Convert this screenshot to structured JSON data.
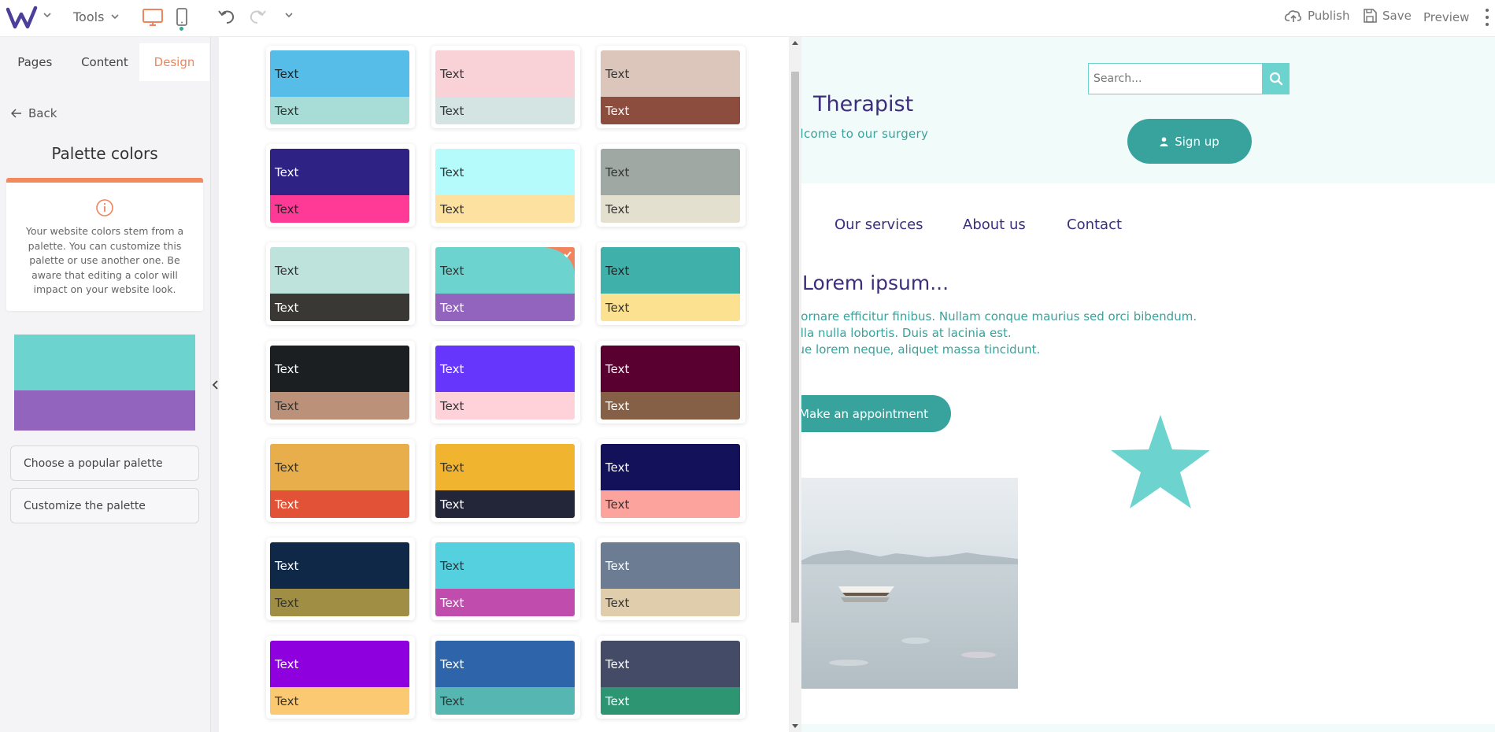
{
  "topbar": {
    "tools_label": "Tools",
    "publish_label": "Publish",
    "save_label": "Save",
    "preview_label": "Preview"
  },
  "colors": {
    "accent_orange": "#f0845e",
    "brand_purple": "#3d2e7c",
    "teal_primary": "#38a39d",
    "teal_light": "#6dd3cf"
  },
  "sidebar": {
    "tabs": [
      {
        "label": "Pages",
        "active": false
      },
      {
        "label": "Content",
        "active": false
      },
      {
        "label": "Design",
        "active": true
      }
    ],
    "back_label": "Back",
    "title": "Palette colors",
    "info_text": "Your website colors stem from a palette. You can customize this palette or use another one. Be aware that editing a color will impact on your website look.",
    "current_palette": {
      "primary": "#6dd3cf",
      "secondary": "#9264bd"
    },
    "choose_label": "Choose a popular palette",
    "customize_label": "Customize the palette"
  },
  "palettes": [
    {
      "top": "#56bde8",
      "top_text": "#222222",
      "bottom": "#a7ddd6",
      "bottom_text": "#333333",
      "label": "Text",
      "selected": false
    },
    {
      "top": "#f9d2d8",
      "top_text": "#333333",
      "bottom": "#d4e4e3",
      "bottom_text": "#333333",
      "label": "Text",
      "selected": false
    },
    {
      "top": "#dcc6bc",
      "top_text": "#333333",
      "bottom": "#8c4d3f",
      "bottom_text": "#ffffff",
      "label": "Text",
      "selected": false
    },
    {
      "top": "#2e2385",
      "top_text": "#ffffff",
      "bottom": "#ff3a96",
      "bottom_text": "#222222",
      "label": "Text",
      "selected": false
    },
    {
      "top": "#b5fbfc",
      "top_text": "#333333",
      "bottom": "#fde1a0",
      "bottom_text": "#333333",
      "label": "Text",
      "selected": false
    },
    {
      "top": "#9fa8a2",
      "top_text": "#333333",
      "bottom": "#e4e0d0",
      "bottom_text": "#333333",
      "label": "Text",
      "selected": false
    },
    {
      "top": "#bee3dc",
      "top_text": "#333333",
      "bottom": "#3a3834",
      "bottom_text": "#ffffff",
      "label": "Text",
      "selected": false
    },
    {
      "top": "#6dd3cf",
      "top_text": "#333333",
      "bottom": "#9264bd",
      "bottom_text": "#ffffff",
      "label": "Text",
      "selected": true
    },
    {
      "top": "#3fb0aa",
      "top_text": "#222222",
      "bottom": "#fbe190",
      "bottom_text": "#333333",
      "label": "Text",
      "selected": false
    },
    {
      "top": "#1c1f22",
      "top_text": "#ffffff",
      "bottom": "#bb9279",
      "bottom_text": "#333333",
      "label": "Text",
      "selected": false
    },
    {
      "top": "#6636fc",
      "top_text": "#ffffff",
      "bottom": "#ffd1d8",
      "bottom_text": "#333333",
      "label": "Text",
      "selected": false
    },
    {
      "top": "#5a0031",
      "top_text": "#ffffff",
      "bottom": "#866046",
      "bottom_text": "#ffffff",
      "label": "Text",
      "selected": false
    },
    {
      "top": "#e7ae4b",
      "top_text": "#333333",
      "bottom": "#e25237",
      "bottom_text": "#ffffff",
      "label": "Text",
      "selected": false
    },
    {
      "top": "#f0b42f",
      "top_text": "#333333",
      "bottom": "#232638",
      "bottom_text": "#ffffff",
      "label": "Text",
      "selected": false
    },
    {
      "top": "#13115a",
      "top_text": "#ffffff",
      "bottom": "#fca39e",
      "bottom_text": "#333333",
      "label": "Text",
      "selected": false
    },
    {
      "top": "#0f2848",
      "top_text": "#ffffff",
      "bottom": "#a08e44",
      "bottom_text": "#333333",
      "label": "Text",
      "selected": false
    },
    {
      "top": "#54d0de",
      "top_text": "#333333",
      "bottom": "#c04dad",
      "bottom_text": "#ffffff",
      "label": "Text",
      "selected": false
    },
    {
      "top": "#6c7d93",
      "top_text": "#ffffff",
      "bottom": "#dfcdab",
      "bottom_text": "#333333",
      "label": "Text",
      "selected": false
    },
    {
      "top": "#8e00de",
      "top_text": "#ffffff",
      "bottom": "#fbc972",
      "bottom_text": "#333333",
      "label": "Text",
      "selected": false
    },
    {
      "top": "#2e64a9",
      "top_text": "#ffffff",
      "bottom": "#56b6b1",
      "bottom_text": "#333333",
      "label": "Text",
      "selected": false
    },
    {
      "top": "#434b67",
      "top_text": "#ffffff",
      "bottom": "#2e9573",
      "bottom_text": "#ffffff",
      "label": "Text",
      "selected": false
    }
  ],
  "site": {
    "title": "Therapist",
    "tagline": "elcome to our surgery",
    "search_placeholder": "Search...",
    "signup_label": "Sign up",
    "nav": [
      "Our services",
      "About us",
      "Contact"
    ],
    "heading": "Lorem ipsum...",
    "lines": [
      "d ornare efficitur finibus. Nullam conque maurius sed orci bibendum.",
      "gilla nulla lobortis. Duis at lacinia est.",
      "que lorem neque, aliquet massa tincidunt."
    ],
    "cta_label": "Make an appointment"
  }
}
